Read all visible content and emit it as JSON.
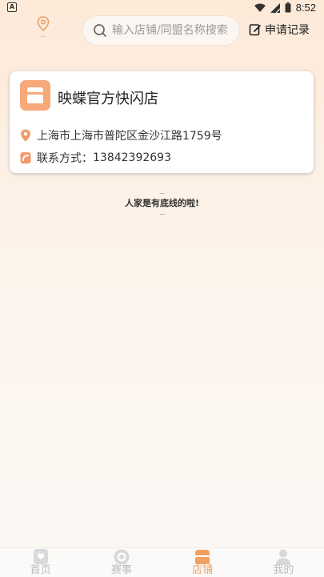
{
  "status_bar": {
    "app_badge": "A",
    "time": "8:52"
  },
  "header": {
    "location_text": "—",
    "search_placeholder": "输入店铺/同盟名称搜索",
    "apply_label": "申请记录"
  },
  "shop": {
    "name": "映蝶官方快闪店",
    "address": "上海市上海市普陀区金沙江路1759号",
    "contact_label": "联系方式：",
    "contact_phone": "13842392693"
  },
  "list_end": {
    "top_dash": "—",
    "text": "人家是有底线的啦!",
    "bottom_dash": "—"
  },
  "tabbar": {
    "tabs": [
      {
        "label": "首页",
        "icon": "home-icon",
        "active": false
      },
      {
        "label": "赛事",
        "icon": "event-icon",
        "active": false
      },
      {
        "label": "店铺",
        "icon": "store-icon",
        "active": true
      },
      {
        "label": "我的",
        "icon": "profile-icon",
        "active": false
      }
    ]
  },
  "colors": {
    "accent": "#f0a160",
    "shop_logo": "#f7a97a"
  }
}
